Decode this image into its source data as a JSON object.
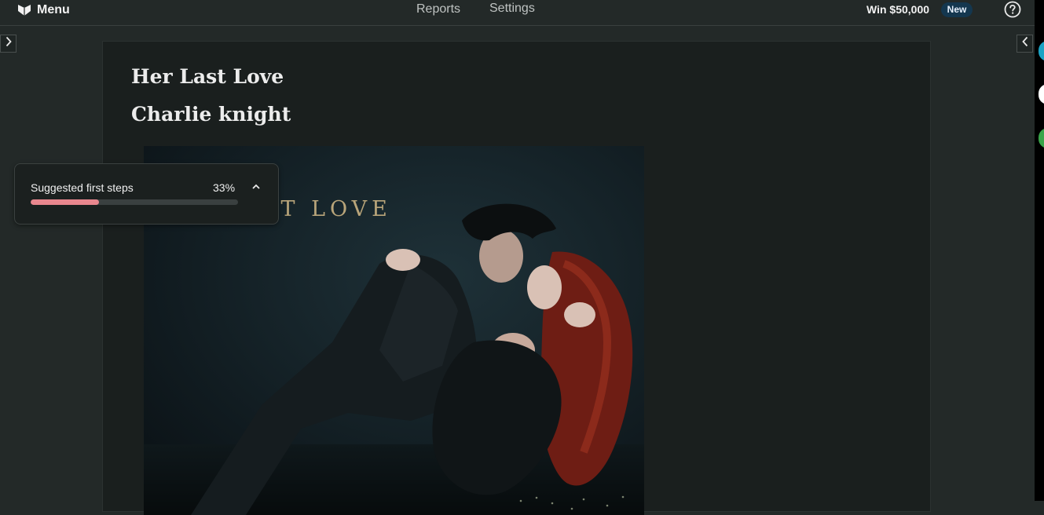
{
  "topbar": {
    "menu_label": "Menu",
    "nav": [
      {
        "label": "Reports"
      },
      {
        "label": "Settings"
      }
    ],
    "promo_label": "Win $50,000",
    "promo_badge": "New"
  },
  "document": {
    "title": "Her Last Love",
    "author": "Charlie knight",
    "cover_text": "ST LOVE"
  },
  "steps": {
    "label": "Suggested first steps",
    "percent_text": "33%",
    "progress": 0.33
  },
  "colors": {
    "accent_progress": "#e9878e",
    "badge_bg": "#14374f",
    "background": "#232928"
  },
  "icons": [
    "logo-icon",
    "help-icon",
    "chevron-right-icon",
    "chevron-left-icon",
    "chevron-up-icon"
  ]
}
